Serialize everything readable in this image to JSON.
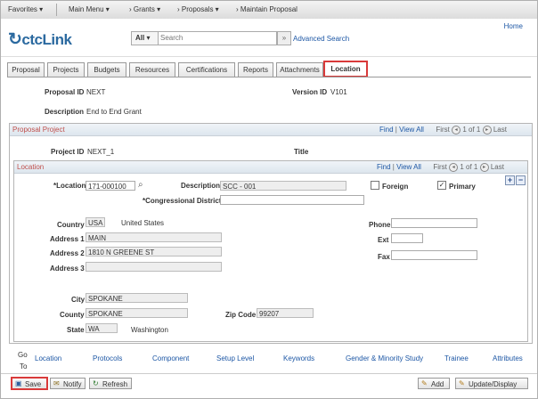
{
  "nav": {
    "favorites": "Favorites ▾",
    "main_menu": "Main Menu ▾",
    "breadcrumb1": "› Grants ▾",
    "breadcrumb2": "› Proposals ▾",
    "breadcrumb3": "› Maintain Proposal"
  },
  "header": {
    "logo_prefix": "c",
    "logo_text": "ctcLink",
    "home": "Home",
    "search_scope": "All",
    "search_placeholder": "Search",
    "advanced_search": "Advanced Search"
  },
  "tabs": [
    "Proposal",
    "Projects",
    "Budgets",
    "Resources",
    "Certifications",
    "Reports",
    "Attachments",
    "Location"
  ],
  "active_tab": "Location",
  "proposal": {
    "id_label": "Proposal ID",
    "id_value": "NEXT",
    "version_label": "Version ID",
    "version_value": "V101",
    "desc_label": "Description",
    "desc_value": "End to End Grant"
  },
  "proposal_project": {
    "title": "Proposal Project",
    "find": "Find",
    "view_all": "View All",
    "first": "First",
    "count": "1 of 1",
    "last": "Last",
    "project_id_label": "Project ID",
    "project_id_value": "NEXT_1",
    "title_label": "Title"
  },
  "location": {
    "title": "Location",
    "find": "Find",
    "view_all": "View All",
    "first": "First",
    "count": "1 of 1",
    "last": "Last",
    "location_label": "*Location",
    "location_value": "171-000100",
    "description_label": "Description",
    "description_value": "SCC - 001",
    "foreign_label": "Foreign",
    "foreign_checked": false,
    "primary_label": "Primary",
    "primary_checked": true,
    "cong_label": "*Congressional District",
    "cong_value": "",
    "country_label": "Country",
    "country_value": "USA",
    "country_name": "United States",
    "addr1_label": "Address 1",
    "addr1_value": "MAIN",
    "addr2_label": "Address 2",
    "addr2_value": "1810 N GREENE ST",
    "addr3_label": "Address 3",
    "addr3_value": "",
    "phone_label": "Phone",
    "phone_value": "",
    "ext_label": "Ext",
    "ext_value": "",
    "fax_label": "Fax",
    "fax_value": "",
    "city_label": "City",
    "city_value": "SPOKANE",
    "county_label": "County",
    "county_value": "SPOKANE",
    "zip_label": "Zip Code",
    "zip_value": "99207",
    "state_label": "State",
    "state_value": "WA",
    "state_name": "Washington"
  },
  "goto": {
    "label_line1": "Go",
    "label_line2": "To",
    "links": [
      "Location",
      "Protocols",
      "Component",
      "Setup Level",
      "Keywords",
      "Gender & Minority Study",
      "Trainee",
      "Attributes"
    ]
  },
  "buttons": {
    "save": "Save",
    "notify": "Notify",
    "refresh": "Refresh",
    "add": "Add",
    "update_display": "Update/Display"
  }
}
